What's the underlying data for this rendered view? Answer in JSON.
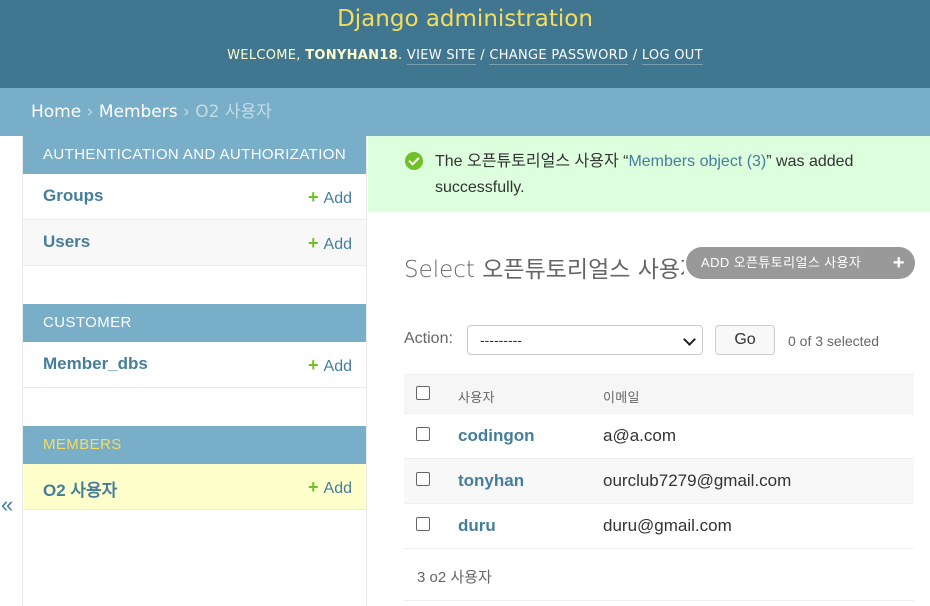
{
  "header": {
    "title": "Django administration",
    "welcome": "WELCOME,",
    "username": "TONYHAN18",
    "view_site": "VIEW SITE",
    "change_password": "CHANGE PASSWORD",
    "log_out": "LOG OUT",
    "separator": "/"
  },
  "breadcrumbs": {
    "home": "Home",
    "app": "Members",
    "current": "O2 사용자",
    "separator": "›"
  },
  "sidebar": {
    "toggle": "«",
    "add_label": "Add",
    "modules": [
      {
        "caption": "AUTHENTICATION AND AUTHORIZATION",
        "models": [
          "Groups",
          "Users"
        ]
      },
      {
        "caption": "CUSTOMER",
        "models": [
          "Member_dbs"
        ]
      },
      {
        "caption": "MEMBERS",
        "models": [
          "O2 사용자"
        ]
      }
    ]
  },
  "message": {
    "prefix": "The 오픈튜토리얼스 사용자 “",
    "link": "Members object (3)",
    "suffix": "” was added successfully."
  },
  "content": {
    "title": "Select 오픈튜토리얼스 사용자 to change",
    "add_button": "ADD 오픈튜토리얼스 사용자",
    "action_label": "Action:",
    "action_value": "---------",
    "go_button": "Go",
    "selection_counter": "0 of 3 selected",
    "columns": [
      "사용자",
      "이메일"
    ],
    "rows": [
      {
        "user": "codingon",
        "email": "a@a.com"
      },
      {
        "user": "tonyhan",
        "email": "ourclub7279@gmail.com"
      },
      {
        "user": "duru",
        "email": "duru@gmail.com"
      }
    ],
    "paginator": "3 o2 사용자"
  },
  "colors": {
    "header_bg": "#417690",
    "breadcrumb_bg": "#79aec8",
    "title_yellow": "#f5dd5d",
    "link_blue": "#447e9b",
    "add_green": "#70bf2b",
    "success_bg": "#ddffdd"
  },
  "icons": {
    "add": "plus-icon",
    "success": "checkmark-circle-icon",
    "dropdown": "chevron-down-icon",
    "collapse": "double-chevron-left-icon"
  }
}
